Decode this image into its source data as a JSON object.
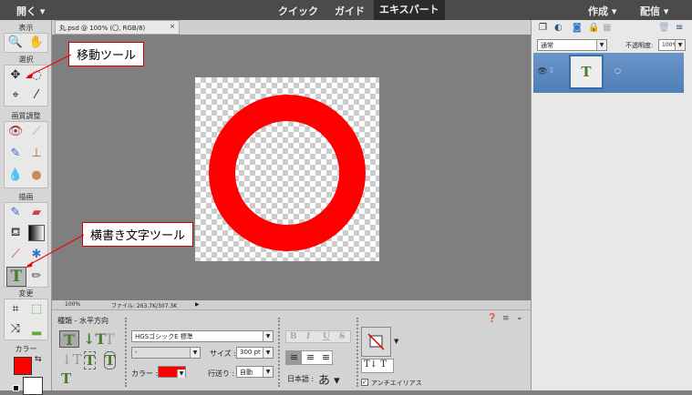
{
  "topbar": {
    "open": "開く",
    "modes": [
      "クイック",
      "ガイド",
      "エキスパート"
    ],
    "active_mode": "エキスパート",
    "create": "作成",
    "share": "配信"
  },
  "tools": {
    "groups": [
      "表示",
      "選択",
      "画質調整",
      "描画",
      "変更",
      "カラー"
    ],
    "foreground_color": "#ff0000",
    "background_color": "#ffffff"
  },
  "document": {
    "tab": "丸.psd @ 100% (〇, RGB/8)",
    "close": "×",
    "zoom": "100%",
    "file_info": "ファイル: 263.7K/307.3K",
    "ring_color": "#ff0000"
  },
  "options": {
    "title": "種類 - 水平方向",
    "font": "HGSゴシックE 標準",
    "style": "-",
    "size_label": "サイズ :",
    "size": "300 pt",
    "color_label": "カラー :",
    "color": "#ff0000",
    "leading_label": "行送り :",
    "leading": "自動",
    "language_label": "日本語 :",
    "bold": "B",
    "italic": "I",
    "underline": "U",
    "strike": "S",
    "antialias": "アンチエイリアス",
    "antialias_checked": true
  },
  "layers": {
    "blend_mode": "通常",
    "opacity_label": "不透明度:",
    "opacity": "100%",
    "layer_thumb": "T"
  },
  "callouts": {
    "move_tool": "移動ツール",
    "horizontal_type_tool": "横書き文字ツール"
  }
}
